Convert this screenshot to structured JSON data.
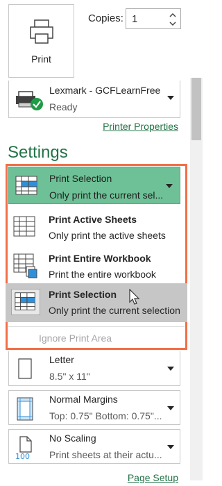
{
  "print": {
    "label": "Print"
  },
  "copies": {
    "label": "Copies:",
    "value": "1"
  },
  "printer": {
    "name": "Lexmark - GCFLearnFree",
    "status": "Ready",
    "properties_link": "Printer Properties"
  },
  "settings": {
    "title": "Settings",
    "selected": {
      "title": "Print Selection",
      "desc": "Only print the current sel..."
    },
    "menu": [
      {
        "title": "Print Active Sheets",
        "desc": "Only print the active sheets"
      },
      {
        "title": "Print Entire Workbook",
        "desc": "Print the entire workbook"
      },
      {
        "title": "Print Selection",
        "desc": "Only print the current selection"
      }
    ],
    "ignore_print_area": "Ignore Print Area"
  },
  "paper": {
    "title": "Letter",
    "desc": "8.5\" x 11\""
  },
  "margins": {
    "title": "Normal Margins",
    "desc": "Top: 0.75\" Bottom: 0.75\"..."
  },
  "scaling": {
    "title": "No Scaling",
    "desc": "Print sheets at their actu...",
    "icon_label": "100"
  },
  "page_setup_link": "Page Setup",
  "colors": {
    "accent": "#217346",
    "selected_bg": "#6ec096",
    "highlight_frame": "#f36e46",
    "hover_bg": "#c6c6c6"
  }
}
